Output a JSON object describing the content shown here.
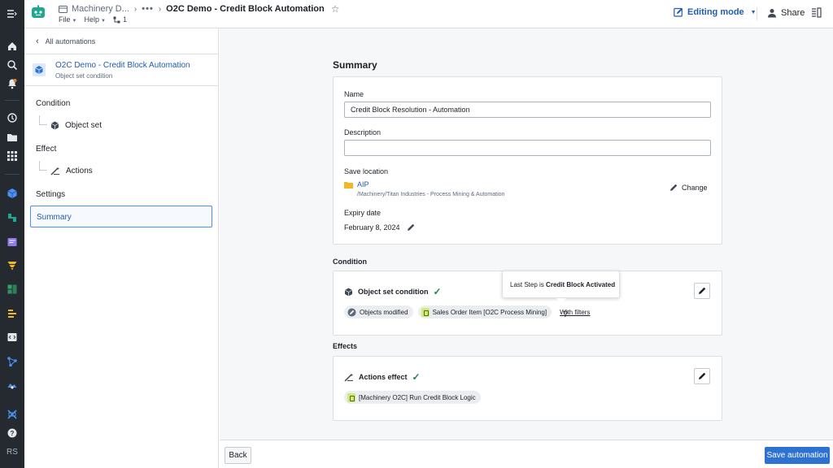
{
  "topbar": {
    "breadcrumb_folder": "Machinery D...",
    "breadcrumb_more": "•••",
    "breadcrumb_current": "O2C Demo - Credit Block Automation",
    "menu_file": "File",
    "menu_help": "Help",
    "resource_count": "1",
    "editing_mode": "Editing mode",
    "share": "Share"
  },
  "rail": {
    "initials": "RS"
  },
  "sidebar": {
    "back_label": "All automations",
    "automation_title": "O2C Demo - Credit Block Automation",
    "automation_subtitle": "Object set condition",
    "condition_label": "Condition",
    "object_set_label": "Object set",
    "effect_label": "Effect",
    "actions_label": "Actions",
    "settings_label": "Settings",
    "summary_label": "Summary"
  },
  "summary": {
    "heading": "Summary",
    "name_label": "Name",
    "name_value": "Credit Block Resolution - Automation",
    "description_label": "Description",
    "description_value": "",
    "save_location_label": "Save location",
    "folder_name": "AIP",
    "folder_path": "/Machinery/Titan Industries - Process Mining & Automation",
    "change_label": "Change",
    "expiry_label": "Expiry date",
    "expiry_value": "February 8, 2024"
  },
  "condition": {
    "heading": "Condition",
    "card_title": "Object set condition",
    "tag_modified": "Objects modified",
    "tag_object": "Sales Order Item [O2C Process Mining]",
    "filters_link": "With filters"
  },
  "tooltip": {
    "prefix": "Last Step is",
    "value": "Credit Block Activated"
  },
  "effects": {
    "heading": "Effects",
    "card_title": "Actions effect",
    "tag_action": "[Machinery O2C] Run Credit Block Logic"
  },
  "footer": {
    "back_label": "Back",
    "save_label": "Save automation"
  },
  "colors": {
    "accent": "#2d72d2",
    "link": "#215db0",
    "success": "#238551",
    "rail": "#252a31"
  }
}
